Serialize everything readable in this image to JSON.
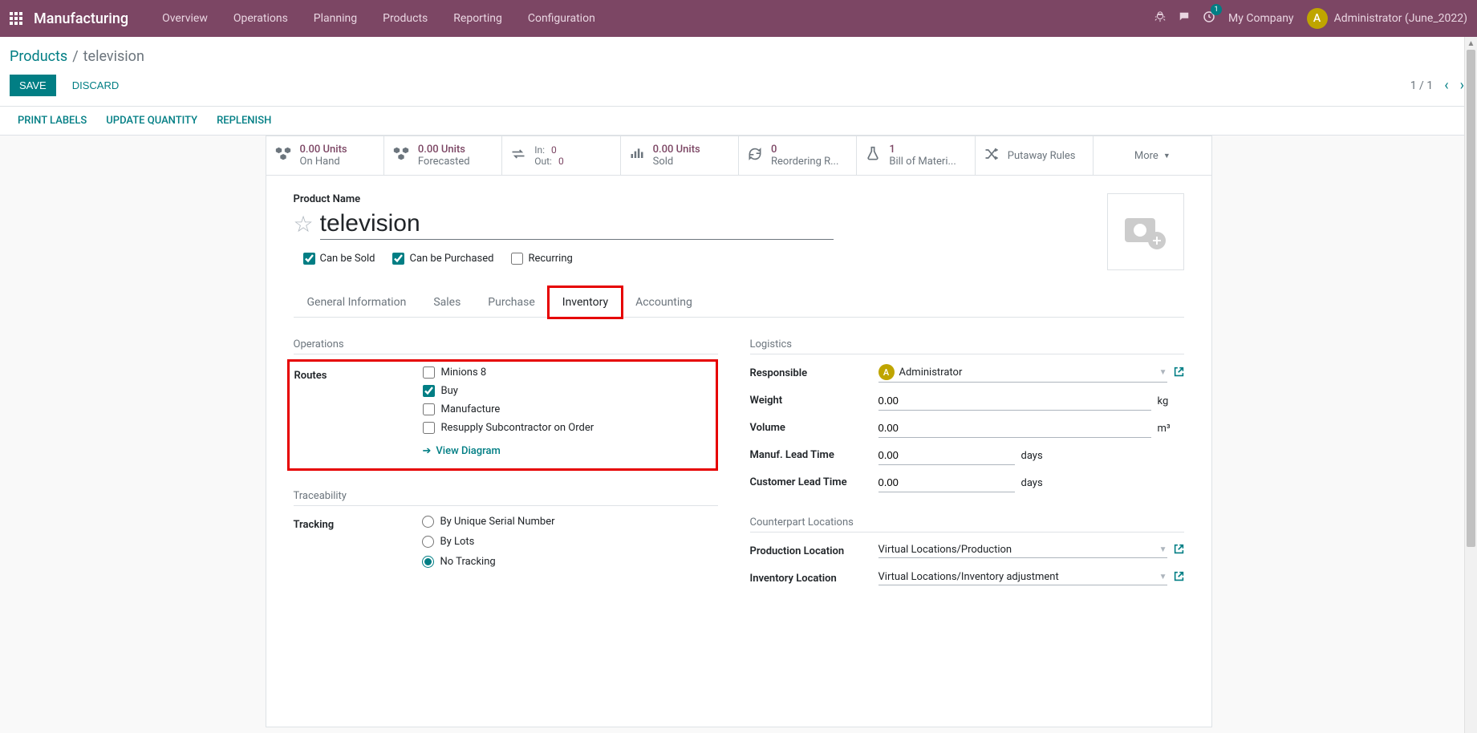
{
  "topbar": {
    "brand": "Manufacturing",
    "nav": [
      "Overview",
      "Operations",
      "Planning",
      "Products",
      "Reporting",
      "Configuration"
    ],
    "notif_count": "1",
    "company": "My Company",
    "avatar_letter": "A",
    "user": "Administrator (June_2022)"
  },
  "breadcrumb": {
    "root": "Products",
    "leaf": "television"
  },
  "actions": {
    "save": "Save",
    "discard": "Discard"
  },
  "pager": {
    "text": "1 / 1"
  },
  "subactions": [
    "Print Labels",
    "Update Quantity",
    "Replenish"
  ],
  "stats": {
    "onhand": {
      "val": "0.00 Units",
      "lbl": "On Hand"
    },
    "forecasted": {
      "val": "0.00 Units",
      "lbl": "Forecasted"
    },
    "inout": {
      "in_k": "In:",
      "in_v": "0",
      "out_k": "Out:",
      "out_v": "0"
    },
    "sold": {
      "val": "0.00 Units",
      "lbl": "Sold"
    },
    "reorder": {
      "val": "0",
      "lbl": "Reordering R..."
    },
    "bom": {
      "val": "1",
      "lbl": "Bill of Materi..."
    },
    "putaway": {
      "lbl": "Putaway Rules"
    },
    "more": "More"
  },
  "product": {
    "label": "Product Name",
    "name": "television",
    "can_be_sold": "Can be Sold",
    "can_be_purchased": "Can be Purchased",
    "recurring": "Recurring"
  },
  "tabs": [
    "General Information",
    "Sales",
    "Purchase",
    "Inventory",
    "Accounting"
  ],
  "inventory": {
    "operations_title": "Operations",
    "routes_label": "Routes",
    "routes": {
      "minions": "Minions 8",
      "buy": "Buy",
      "manufacture": "Manufacture",
      "resupply": "Resupply Subcontractor on Order"
    },
    "view_diagram": "View Diagram",
    "traceability_title": "Traceability",
    "tracking_label": "Tracking",
    "tracking": {
      "serial": "By Unique Serial Number",
      "lots": "By Lots",
      "none": "No Tracking"
    },
    "logistics_title": "Logistics",
    "responsible_label": "Responsible",
    "responsible_value": "Administrator",
    "weight_label": "Weight",
    "weight_value": "0.00",
    "weight_unit": "kg",
    "volume_label": "Volume",
    "volume_value": "0.00",
    "volume_unit": "m³",
    "manuf_lead_label": "Manuf. Lead Time",
    "manuf_lead_value": "0.00",
    "cust_lead_label": "Customer Lead Time",
    "cust_lead_value": "0.00",
    "days_unit": "days",
    "counterpart_title": "Counterpart Locations",
    "prod_loc_label": "Production Location",
    "prod_loc_value": "Virtual Locations/Production",
    "inv_loc_label": "Inventory Location",
    "inv_loc_value": "Virtual Locations/Inventory adjustment"
  }
}
